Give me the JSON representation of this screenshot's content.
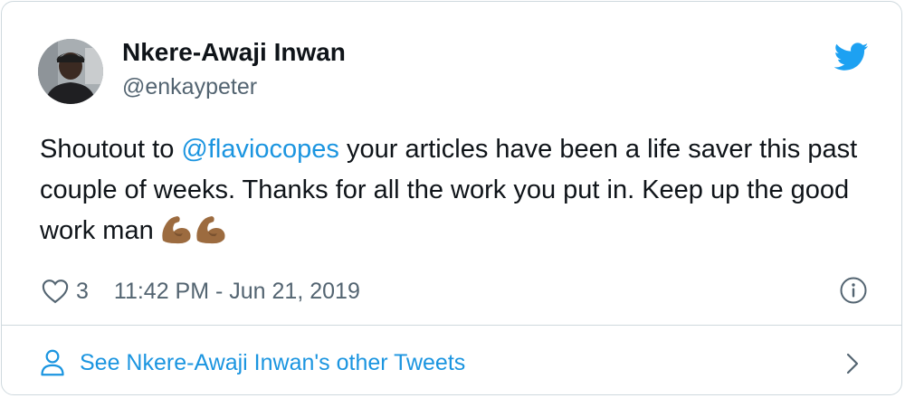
{
  "author": {
    "name": "Nkere-Awaji Inwan",
    "handle": "@enkaypeter",
    "avatar_icon": "profile-photo"
  },
  "tweet": {
    "text_before_mention": "Shoutout to ",
    "mention": "@flaviocopes",
    "text_after_mention": " your articles have been a life saver this past couple of weeks. Thanks for all the work you put in. Keep up the good work man",
    "emoji": "flexed-biceps-medium-dark-skin-tone x2"
  },
  "meta": {
    "like_count": "3",
    "timestamp": "11:42 PM - Jun 21, 2019",
    "like_icon": "heart-icon",
    "info_icon": "info-icon"
  },
  "footer": {
    "link_label": "See Nkere-Awaji Inwan's other Tweets",
    "person_icon": "person-icon",
    "chevron_icon": "chevron-right-icon"
  },
  "colors": {
    "brand_blue": "#1da1f2",
    "link_blue": "#1b95e0",
    "text_primary": "#0f1419",
    "text_secondary": "#536471",
    "border": "#cfd9de",
    "emoji_skin": "#9c6b3f"
  }
}
